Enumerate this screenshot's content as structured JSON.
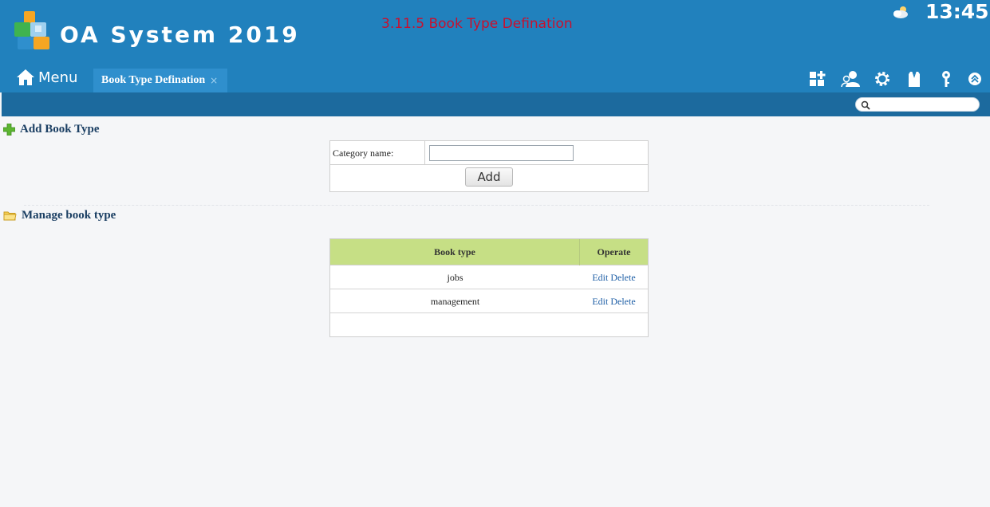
{
  "header": {
    "app_title": "OA System 2019",
    "page_heading": "3.11.5 Book Type Defination",
    "time": "13:45",
    "menu_label": "Menu",
    "active_tab": "Book Type Defination",
    "tab_close": "×",
    "toolbar_icons": [
      "add-module-icon",
      "users-icon",
      "settings-gear-icon",
      "shirt-icon",
      "key-icon",
      "collapse-up-icon"
    ],
    "search_placeholder": ""
  },
  "colors": {
    "header_bg": "#2181bd",
    "subbar_bg": "#1c6a9e",
    "heading_red": "#c8102e",
    "table_header_bg": "#c6df85",
    "link": "#1f5fa6"
  },
  "add_section": {
    "title": "Add Book Type",
    "category_label": "Category name:",
    "category_value": "",
    "add_button": "Add"
  },
  "manage_section": {
    "title": "Manage book type",
    "columns": [
      "Book type",
      "Operate"
    ],
    "rows": [
      {
        "type": "jobs",
        "edit": "Edit",
        "delete": "Delete"
      },
      {
        "type": "management",
        "edit": "Edit",
        "delete": "Delete"
      }
    ]
  }
}
